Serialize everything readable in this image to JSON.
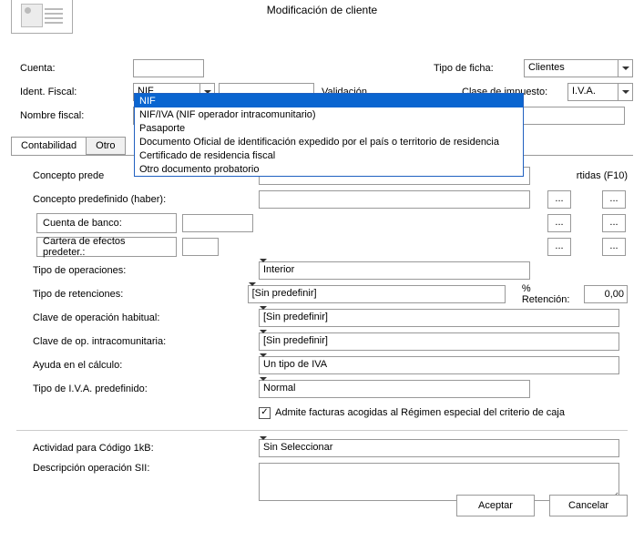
{
  "title": "Modificación de cliente",
  "top": {
    "lbl_cuenta": "Cuenta:",
    "lbl_ident": "Ident. Fiscal:",
    "sel_ident": "NIF",
    "validacion": "Validación",
    "lbl_tipo_ficha": "Tipo de ficha:",
    "sel_tipo_ficha": "Clientes",
    "lbl_clase": "Clase de impuesto:",
    "sel_clase": "I.V.A.",
    "lbl_nombre": "Nombre fiscal:"
  },
  "ident_fiscal_options": [
    "NIF",
    "NIF/IVA (NIF operador intracomunitario)",
    "Pasaporte",
    "Documento Oficial de identificación expedido por el país o territorio de residencia",
    "Certificado de residencia fiscal",
    "Otro documento probatorio"
  ],
  "tabs": {
    "active": "Contabilidad",
    "hidden_prefix": "Otro"
  },
  "body": {
    "concepto_prede_lbl": "Concepto prede",
    "concepto_haber_lbl": "Concepto predefinido (haber):",
    "cuenta_banco_lbl": "Cuenta de banco:",
    "cartera_lbl": "Cartera de efectos predeter.:",
    "tipo_op_lbl": "Tipo de operaciones:",
    "tipo_op_val": "Interior",
    "tipo_ret_lbl": "Tipo de retenciones:",
    "tipo_ret_val": "[Sin predefinir]",
    "pct_ret_lbl": "% Retención:",
    "pct_ret_val": "0,00",
    "clave_hab_lbl": "Clave de operación habitual:",
    "clave_hab_val": "[Sin predefinir]",
    "clave_intra_lbl": "Clave de op. intracomunitaria:",
    "clave_intra_val": "[Sin predefinir]",
    "ayuda_lbl": "Ayuda en el cálculo:",
    "ayuda_val": "Un tipo de IVA",
    "iva_pred_lbl": "Tipo de I.V.A. predefinido:",
    "iva_pred_val": "Normal",
    "chk_caja": "Admite facturas acogidas al Régimen especial del criterio de caja",
    "act_1kb_lbl": "Actividad para Código 1kB:",
    "act_1kb_val": "Sin Seleccionar",
    "desc_sii_lbl": "Descripción operación SII:",
    "contrapartidas_hint": "rtidas (F10)"
  },
  "dots": "...",
  "buttons": {
    "accept": "Aceptar",
    "cancel": "Cancelar"
  }
}
